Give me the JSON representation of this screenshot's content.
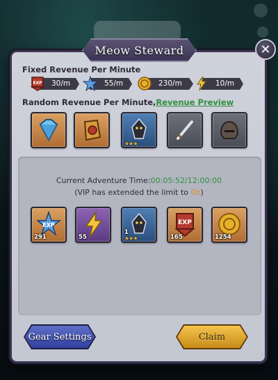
{
  "dialog": {
    "title": "Meow Steward",
    "close_label": "✕"
  },
  "fixed_revenue": {
    "label": "Fixed Revenue Per Minute",
    "items": [
      {
        "icon": "exp-banner-icon",
        "value": "30/m"
      },
      {
        "icon": "exp-star-icon",
        "value": "55/m"
      },
      {
        "icon": "gold-coin-icon",
        "value": "230/m"
      },
      {
        "icon": "energy-bolt-icon",
        "value": "10/m"
      }
    ]
  },
  "random_revenue": {
    "label": "Random Revenue Per Minute,",
    "link": "Revenue Preview",
    "items": [
      {
        "icon": "diamond-icon",
        "rarity": "orange"
      },
      {
        "icon": "rune-scroll-icon",
        "rarity": "orange"
      },
      {
        "icon": "hero-shard-icon",
        "rarity": "blue",
        "stars": "★★★"
      },
      {
        "icon": "sword-icon",
        "rarity": "grey"
      },
      {
        "icon": "helmet-icon",
        "rarity": "grey"
      }
    ]
  },
  "adventure": {
    "time_label": "Current Adventure Time:",
    "time_value": "00:05:52/12:00:00",
    "vip_prefix": "(VIP has extended the limit to ",
    "vip_value": "0h",
    "vip_suffix": ")",
    "rewards": [
      {
        "icon": "exp-star-icon",
        "count": "291",
        "rarity": "orange"
      },
      {
        "icon": "energy-bolt-icon",
        "count": "55",
        "rarity": "purple"
      },
      {
        "icon": "hero-shard-icon",
        "count": "1",
        "rarity": "blue",
        "stars": "★★★"
      },
      {
        "icon": "exp-banner-icon",
        "count": "165",
        "rarity": "orange"
      },
      {
        "icon": "gold-coin-icon",
        "count": "1254",
        "rarity": "orange"
      }
    ]
  },
  "buttons": {
    "gear_settings": "Gear Settings",
    "claim": "Claim"
  },
  "colors": {
    "accent_green": "#2f8f3e",
    "accent_orange": "#e08a1c",
    "panel_bg": "#cfd2db",
    "title_plate": "#4a4462"
  }
}
